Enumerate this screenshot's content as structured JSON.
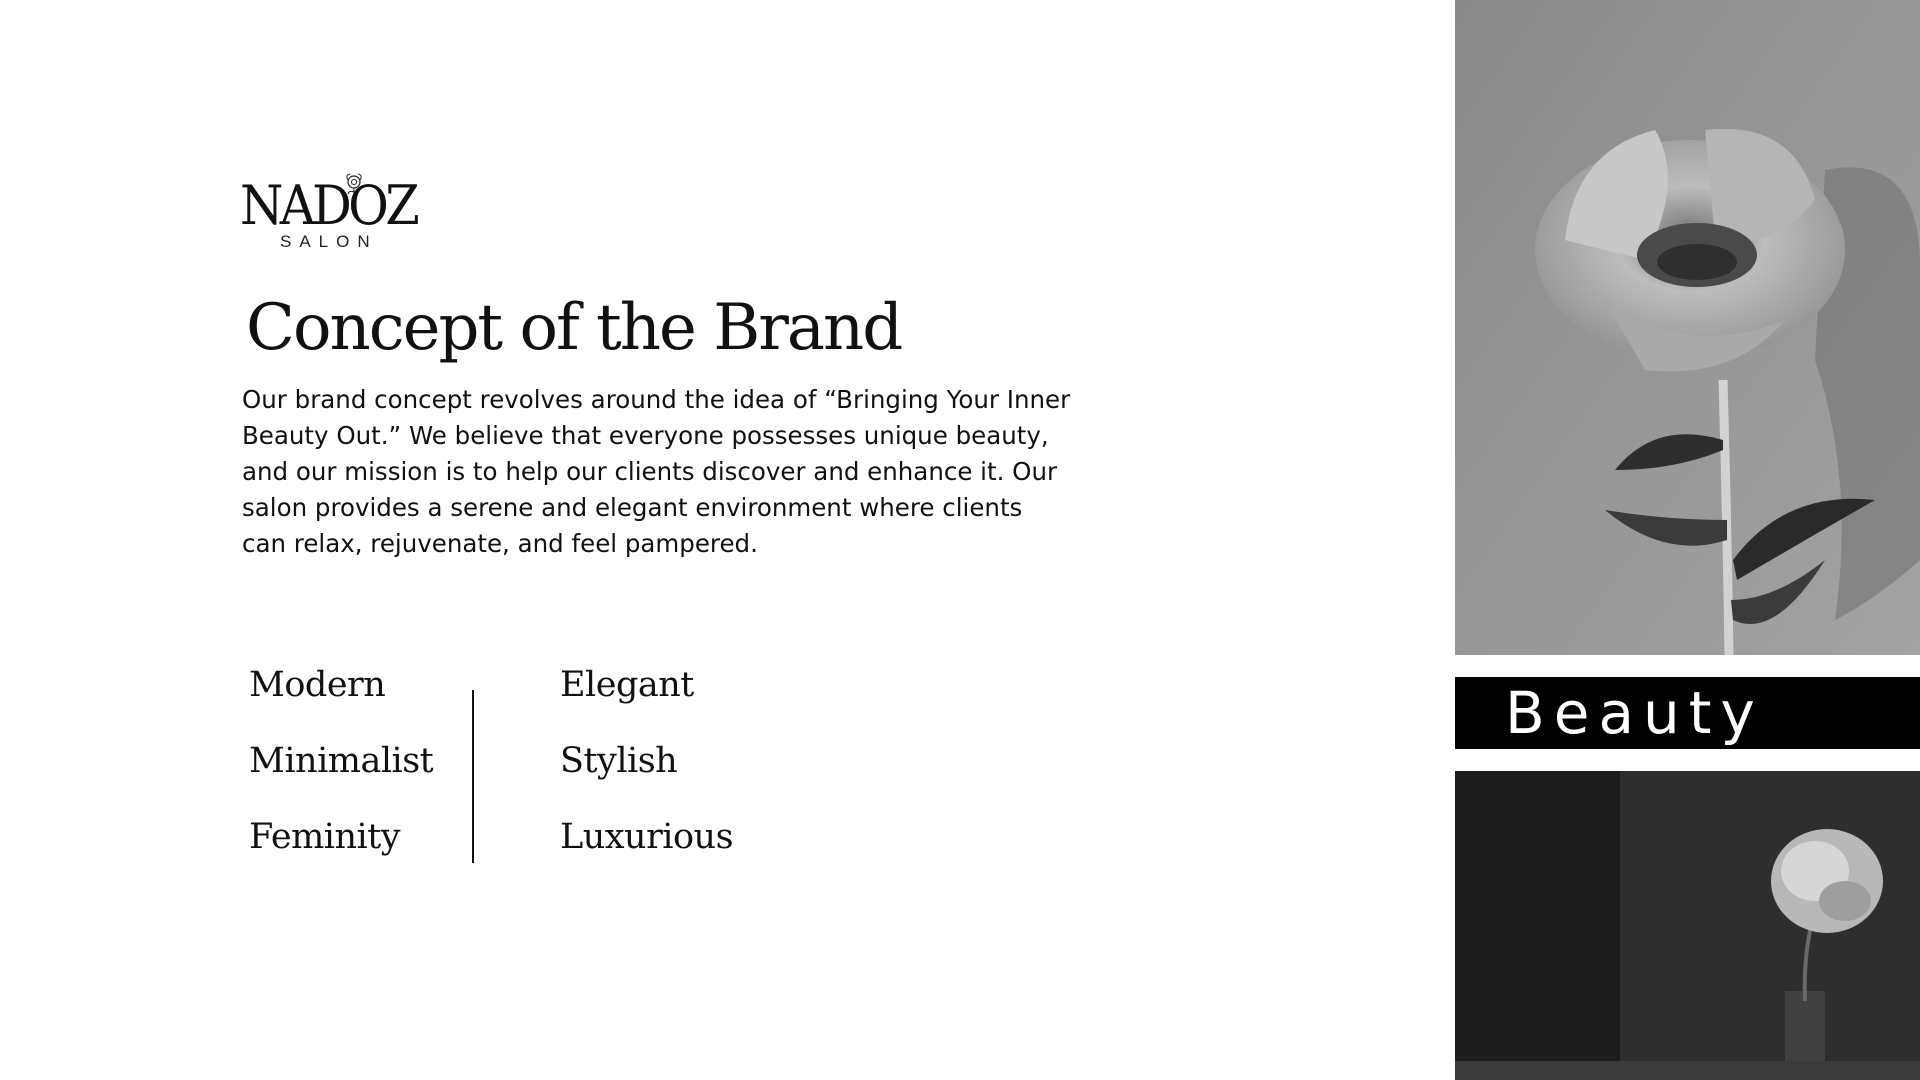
{
  "logo": {
    "wordmark": "NADOZ",
    "subtitle": "SALON"
  },
  "title": "Concept of the Brand",
  "body": "Our brand concept revolves around the idea of “Bringing Your Inner Beauty Out.” We believe that everyone possesses unique beauty, and our mission is to help our clients discover and enhance it. Our salon provides a serene and elegant environment where clients can relax, rejuvenate, and feel pampered.",
  "keywords": {
    "left": [
      "Modern",
      "Minimalist",
      "Feminity"
    ],
    "right": [
      "Elegant",
      "Stylish",
      "Luxurious"
    ]
  },
  "banner": {
    "label": "Beauty"
  },
  "colors": {
    "text": "#111111",
    "background": "#ffffff",
    "banner": "#000000"
  },
  "icons": [
    "peony-logo-icon"
  ]
}
